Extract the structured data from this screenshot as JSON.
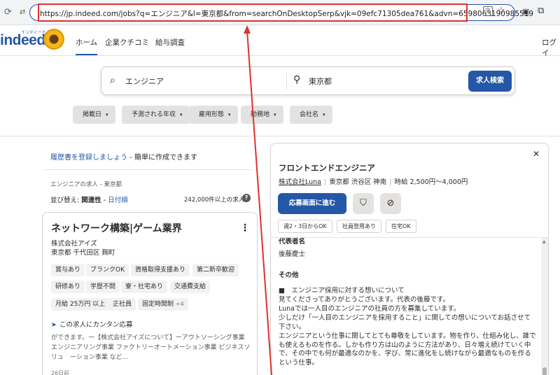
{
  "browser": {
    "url": "https://jp.indeed.com/jobs?q=エンジニア&l=東京都&from=searchOnDesktopSerp&vjk=09efc71305dea761&advn=6598063190985519"
  },
  "header": {
    "logo_text": "indeed",
    "logo_sub": "インディード",
    "nav": [
      "ホーム",
      "企業クチコミ",
      "給与調査"
    ],
    "login": "ログイ"
  },
  "search": {
    "what": "エンジニア",
    "where": "東京都",
    "button": "求人検索"
  },
  "filters": [
    "掲載日",
    "予測される年収",
    "雇用形態",
    "勤務地",
    "会社名"
  ],
  "left": {
    "resume_link": "履歴書を登録しましょう",
    "resume_rest": " - 簡単に作成できます",
    "breadcrumb": "エンジニアの求人 - 東京都",
    "sort_prefix": "並び替え: ",
    "sort_relevance": "関連性",
    "sort_sep": " - ",
    "sort_date": "日付順",
    "count": "242,000件以上の求人",
    "help": "?"
  },
  "job_card": {
    "title": "ネットワーク構築|ゲーム業界",
    "company": "株式会社アイズ",
    "location": "東京都 千代田区 麹町",
    "tags_row1": [
      "賞与あり",
      "ブランクOK",
      "資格取得支援あり",
      "第二新卒歓迎"
    ],
    "tags_row2": [
      "研修あり",
      "学歴不問",
      "寮・社宅あり",
      "交通費支給"
    ],
    "tags_row3": [
      "月給 25万円 以上",
      "正社員",
      "固定時間制"
    ],
    "more_tags": "+4",
    "easy_apply": "この求人にカンタン応募",
    "snippet": "ができます。ー【株式会社アイズについて】ーアウトソーシング事業 エンジニアリング事業 ファクトリーオートメーション事業 ビジネスソリュ　ーション事業 など...",
    "posted": "26日前"
  },
  "detail": {
    "title": "フロントエンドエンジニア",
    "company": "株式会社Luna",
    "location": "東京都 渋谷区 神南",
    "salary": "時給 2,500円～4,000円",
    "apply": "応募画面に進む",
    "tags": [
      "週2・3日からOK",
      "社員登用あり",
      "在宅OK"
    ],
    "rep_label": "代表者名",
    "rep_name": "後藤慶士",
    "other_heading": "その他",
    "bullet": "■　エンジニア採用に対する想いについて",
    "paragraphs": [
      "見てくださってありがとうございます。代表の後藤です。",
      "Lunaでは一人目のエンジニアの社員の方を募集しています。",
      "少しだけ「一人目のエンジニアを採用すること」に関しての想いについてお話させて下さい。",
      "エンジニアという仕事に関してとても尊敬をしています。物を作り、仕組み化し、誰でも使えるものを作る。しかも作り方は山のように方法があり、日々増え続けていく中で、その中でも何が最適なのかを、学び、常に進化をし続けながら最適なものを作るという仕事。"
    ]
  }
}
